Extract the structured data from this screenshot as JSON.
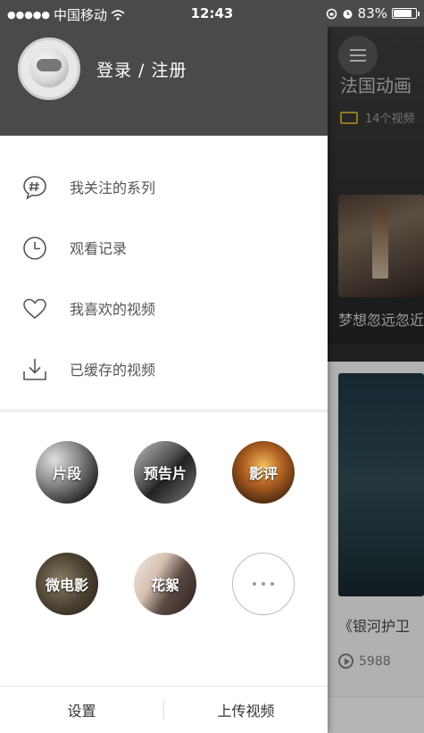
{
  "status_bar": {
    "carrier": "中国移动",
    "time": "12:43",
    "battery": "83%",
    "battery_level": 0.83
  },
  "drawer": {
    "login_text": "登录 / 注册",
    "menu": [
      {
        "label": "我关注的系列",
        "icon": "hashtag-chat-icon"
      },
      {
        "label": "观看记录",
        "icon": "clock-icon"
      },
      {
        "label": "我喜欢的视频",
        "icon": "heart-icon"
      },
      {
        "label": "已缓存的视频",
        "icon": "download-icon"
      }
    ],
    "categories": [
      {
        "label": "片段"
      },
      {
        "label": "预告片"
      },
      {
        "label": "影评"
      },
      {
        "label": "微电影"
      },
      {
        "label": "花絮"
      },
      {
        "label": ""
      }
    ],
    "footer": {
      "settings": "设置",
      "upload": "上传视频"
    }
  },
  "background": {
    "series_title": "法国动画",
    "video_count": "14个视频",
    "card1_caption": "梦想忽远忽近",
    "card2_caption": "《银河护卫",
    "card2_plays": "5988"
  },
  "colors": {
    "header_bg": "#4a4a4a",
    "accent_yellow": "#c9a227"
  }
}
